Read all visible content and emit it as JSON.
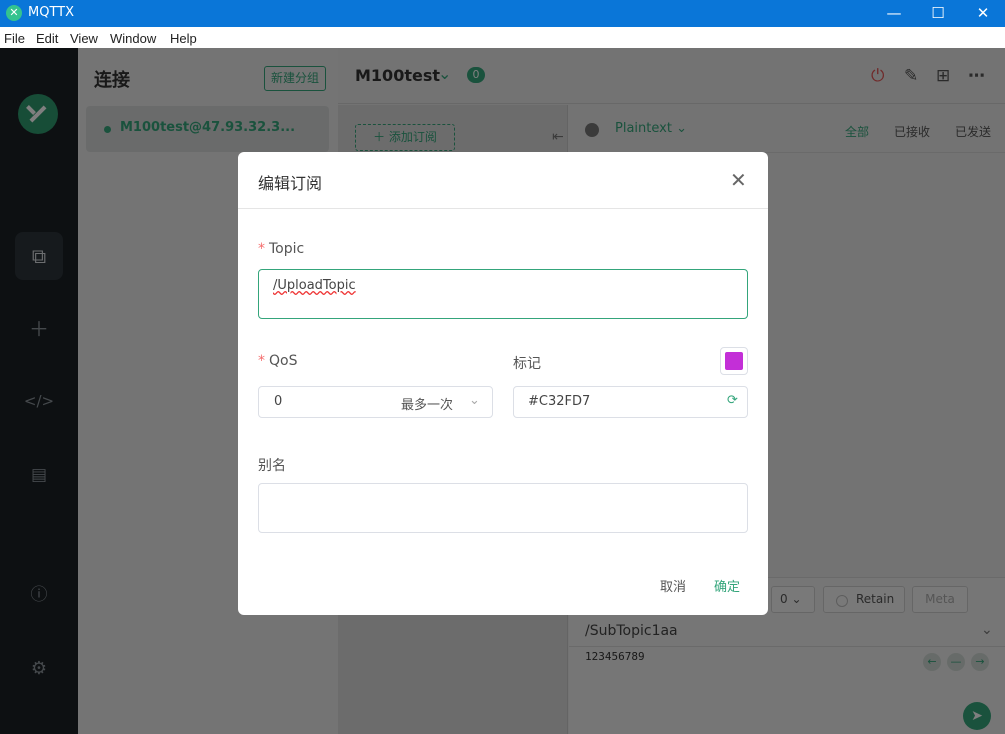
{
  "window": {
    "app_title": "MQTTX",
    "minimize": "—",
    "maximize": "☐",
    "close": "✕"
  },
  "menu": [
    "File",
    "Edit",
    "View",
    "Window",
    "Help"
  ],
  "sidebar": {
    "heading": "连接",
    "new_group_label": "新建分组",
    "connection_name": "M100test@47.93.32.3..."
  },
  "main": {
    "connection_title": "M100test",
    "badge_count": "0",
    "add_subscription_label": "添加订阅",
    "payload_format": "Plaintext",
    "filter_all": "全部",
    "filter_received": "已接收",
    "filter_sent": "已发送",
    "publish_qos": "0",
    "retain_label": "Retain",
    "meta_label": "Meta",
    "publish_topic": "/SubTopic1aa",
    "publish_payload": "123456789"
  },
  "dialog": {
    "title": "编辑订阅",
    "topic_label": "Topic",
    "topic_value": "/UploadTopic",
    "qos_label": "QoS",
    "qos_value": "0",
    "qos_description": "最多一次",
    "mark_label": "标记",
    "color_value": "#C32FD7",
    "alias_label": "别名",
    "alias_value": "",
    "cancel_label": "取消",
    "confirm_label": "确定"
  },
  "colors": {
    "accent": "#34a57b",
    "titlebar": "#0a76d8",
    "required": "#f56c6c",
    "danger": "#e05555"
  },
  "icons": [
    "logo-icon",
    "connections-icon",
    "plus-icon",
    "script-icon",
    "log-icon",
    "info-icon",
    "settings-icon",
    "power-icon",
    "edit-icon",
    "new-window-icon",
    "more-icon",
    "close-icon",
    "chevron-down-icon",
    "refresh-icon",
    "send-icon"
  ]
}
